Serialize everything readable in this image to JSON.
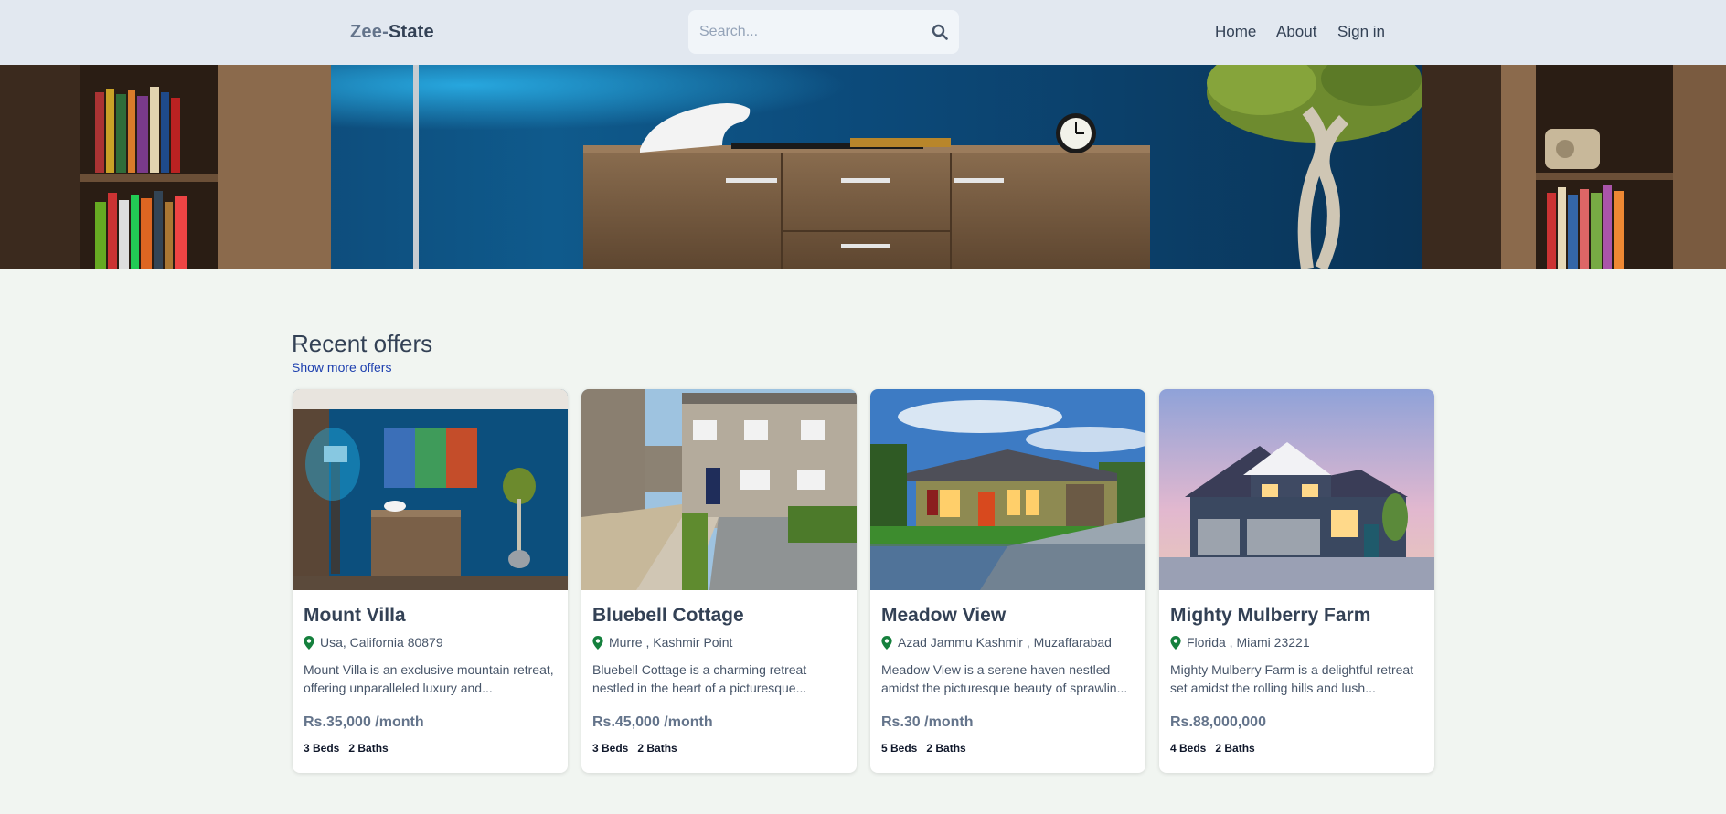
{
  "header": {
    "logo_part1": "Zee-",
    "logo_part2": "State",
    "search_placeholder": "Search...",
    "nav": [
      "Home",
      "About",
      "Sign in"
    ]
  },
  "offers": {
    "title": "Recent offers",
    "show_more": "Show more offers",
    "cards": [
      {
        "title": "Mount Villa",
        "location": "Usa, California 80879",
        "description": "Mount Villa is an exclusive mountain retreat, offering unparalleled luxury and...",
        "price": "Rs.35,000 /month",
        "beds": "3 Beds",
        "baths": "2 Baths"
      },
      {
        "title": "Bluebell Cottage",
        "location": "Murre , Kashmir Point",
        "description": "Bluebell Cottage is a charming retreat nestled in the heart of a picturesque...",
        "price": "Rs.45,000 /month",
        "beds": "3 Beds",
        "baths": "2 Baths"
      },
      {
        "title": "Meadow View",
        "location": "Azad Jammu Kashmir , Muzaffarabad",
        "description": "Meadow View is a serene haven nestled amidst the picturesque beauty of sprawlin...",
        "price": "Rs.30 /month",
        "beds": "5 Beds",
        "baths": "2 Baths"
      },
      {
        "title": "Mighty Mulberry Farm",
        "location": "Florida , Miami 23221",
        "description": "Mighty Mulberry Farm is a delightful retreat set amidst the rolling hills and lush...",
        "price": "Rs.88,000,000",
        "beds": "4 Beds",
        "baths": "2 Baths"
      }
    ]
  },
  "colors": {
    "header_bg": "#e2e8f0",
    "page_bg": "#f1f5f1",
    "text": "#334155",
    "link": "#1e40af",
    "pin": "#15803d"
  },
  "icons": {
    "search": "search-icon",
    "location": "map-pin-icon"
  }
}
